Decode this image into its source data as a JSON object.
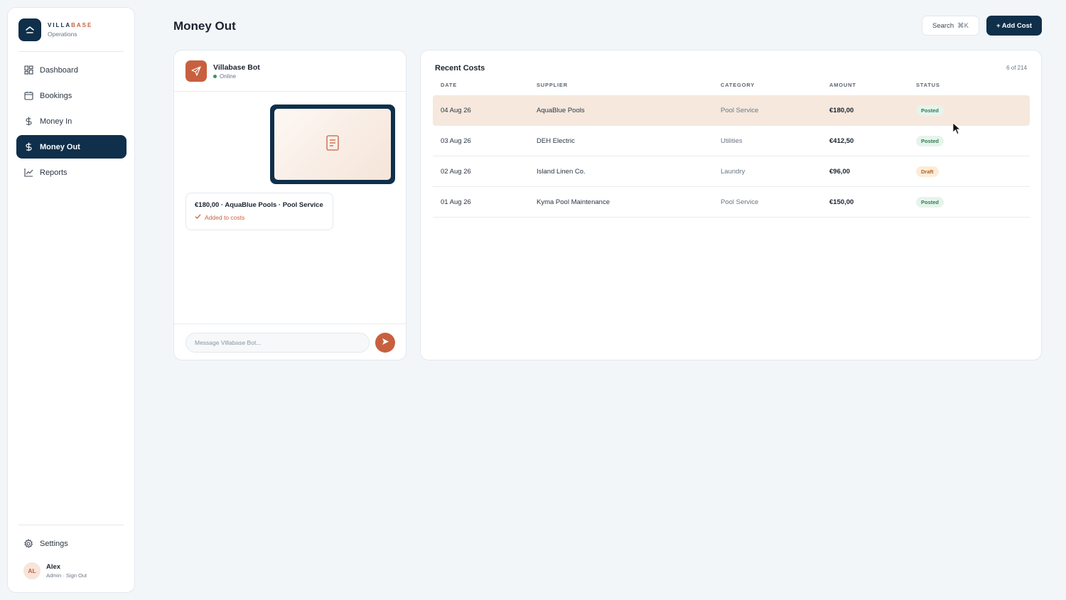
{
  "brand": {
    "name_a": "VILLA",
    "name_b": "BASE",
    "subtitle": "Operations"
  },
  "nav": [
    {
      "label": "Dashboard",
      "icon": "grid-icon",
      "active": false
    },
    {
      "label": "Bookings",
      "icon": "calendar-icon",
      "active": false
    },
    {
      "label": "Money In",
      "icon": "dollar-icon",
      "active": false
    },
    {
      "label": "Money Out",
      "icon": "dollar-icon",
      "active": true
    },
    {
      "label": "Reports",
      "icon": "chart-icon",
      "active": false
    }
  ],
  "settings_label": "Settings",
  "user": {
    "initials": "AL",
    "name": "Alex",
    "role": "Admin · Sign Out"
  },
  "header": {
    "title": "Money Out",
    "search_label": "Search",
    "search_shortcut": "⌘K",
    "add_label": "+ Add Cost"
  },
  "chat": {
    "bot_name": "Villabase Bot",
    "status": "Online",
    "message_main": "€180,00 · AquaBlue Pools · Pool Service",
    "message_sub": "Added to costs",
    "input_placeholder": "Message Villabase Bot..."
  },
  "costs": {
    "title": "Recent Costs",
    "count": "6 of 214",
    "columns": [
      "DATE",
      "SUPPLIER",
      "CATEGORY",
      "AMOUNT",
      "STATUS"
    ],
    "rows": [
      {
        "date": "04 Aug 26",
        "supplier": "AquaBlue Pools",
        "category": "Pool Service",
        "amount": "€180,00",
        "status": "Posted"
      },
      {
        "date": "03 Aug 26",
        "supplier": "DEH Electric",
        "category": "Utilities",
        "amount": "€412,50",
        "status": "Posted"
      },
      {
        "date": "02 Aug 26",
        "supplier": "Island Linen Co.",
        "category": "Laundry",
        "amount": "€96,00",
        "status": "Draft"
      },
      {
        "date": "01 Aug 26",
        "supplier": "Kyma Pool Maintenance",
        "category": "Pool Service",
        "amount": "€150,00",
        "status": "Posted"
      }
    ]
  },
  "colors": {
    "navy": "#0f2f4a",
    "accent": "#c8603f",
    "highlight_row": "#f6e8dc"
  }
}
